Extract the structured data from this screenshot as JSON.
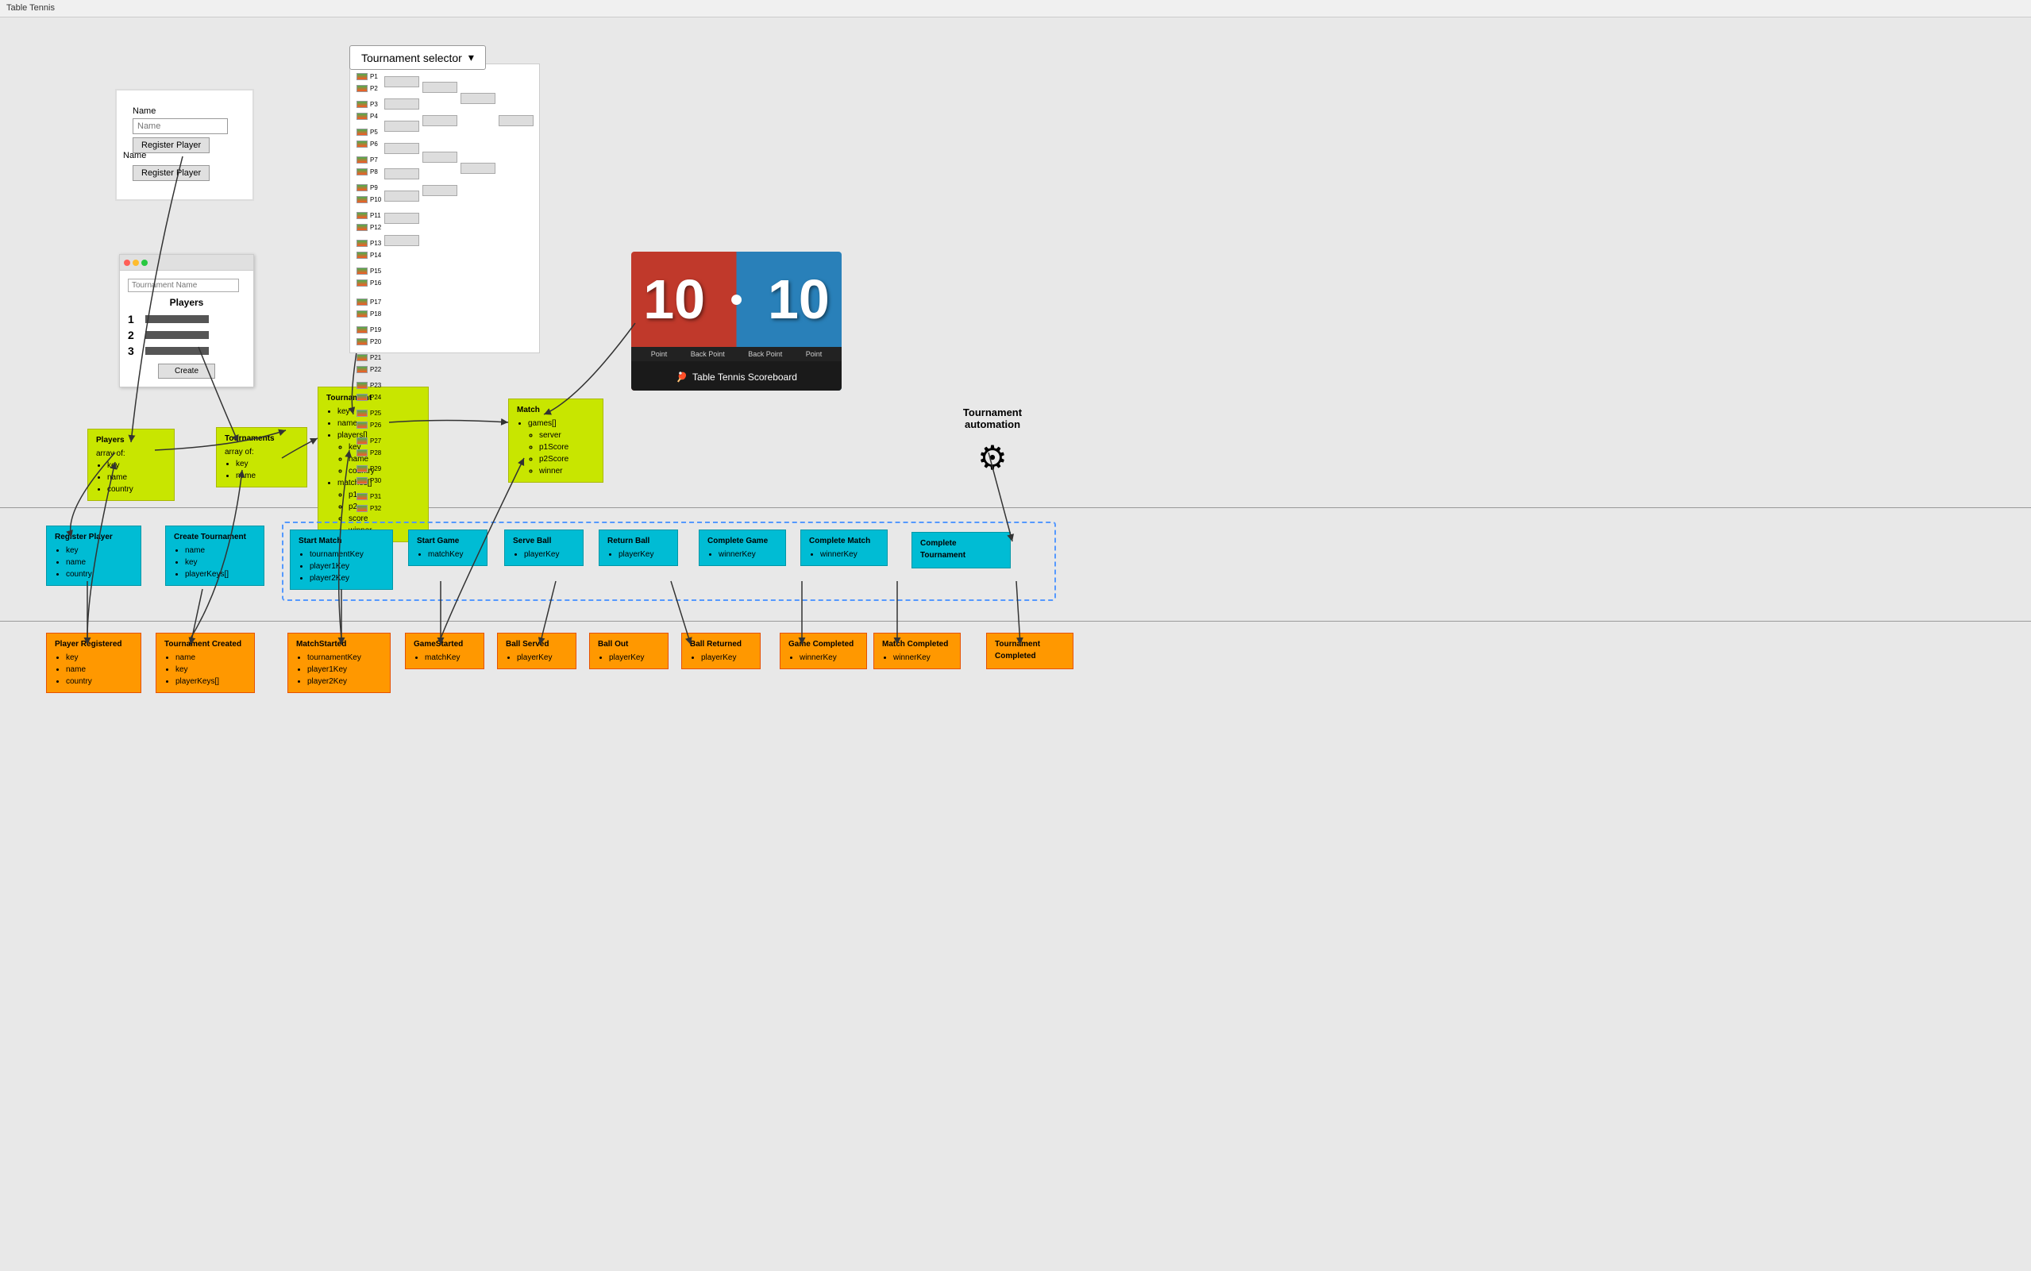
{
  "app": {
    "title": "Table Tennis"
  },
  "tournament_selector": {
    "label": "Tournament selector",
    "chevron": "▾"
  },
  "players_data_box": {
    "title": "Players",
    "subtitle": "array of:",
    "fields": [
      "key",
      "name",
      "country"
    ]
  },
  "tournaments_data_box": {
    "title": "Tournaments",
    "subtitle": "array of:",
    "fields": [
      "key",
      "name"
    ]
  },
  "tournament_data_box": {
    "title": "Tournament",
    "fields": [
      "key",
      "name",
      "players[]",
      "key",
      "name",
      "country",
      "matches[]",
      "p1",
      "p2",
      "score",
      "winner"
    ]
  },
  "match_data_box": {
    "title": "Match",
    "fields": [
      "games[]",
      "server",
      "p1Score",
      "p2Score",
      "winner"
    ]
  },
  "commands": [
    {
      "title": "Register Player",
      "fields": [
        "key",
        "name",
        "country"
      ]
    },
    {
      "title": "Create Tournament",
      "fields": [
        "name",
        "key",
        "playerKeys[]"
      ]
    },
    {
      "title": "Start Match",
      "fields": [
        "tournamentKey",
        "player1Key",
        "player2Key"
      ]
    },
    {
      "title": "Start Game",
      "fields": [
        "matchKey"
      ]
    },
    {
      "title": "Serve Ball",
      "fields": [
        "playerKey"
      ]
    },
    {
      "title": "Return Ball",
      "fields": [
        "playerKey"
      ]
    },
    {
      "title": "Complete Game",
      "fields": [
        "winnerKey"
      ]
    },
    {
      "title": "Complete Match",
      "fields": [
        "winnerKey"
      ]
    },
    {
      "title": "Complete Tournament",
      "fields": []
    }
  ],
  "events": [
    {
      "title": "Player Registered",
      "fields": [
        "key",
        "name",
        "country"
      ]
    },
    {
      "title": "Tournament Created",
      "fields": [
        "name",
        "key",
        "playerKeys[]"
      ]
    },
    {
      "title": "MatchStarted",
      "fields": [
        "tournamentKey",
        "player1Key",
        "player2Key"
      ]
    },
    {
      "title": "GameStarted",
      "fields": [
        "matchKey"
      ]
    },
    {
      "title": "Ball Served",
      "fields": [
        "playerKey"
      ]
    },
    {
      "title": "Ball Out",
      "fields": [
        "playerKey"
      ]
    },
    {
      "title": "Ball Returned",
      "fields": [
        "playerKey"
      ]
    },
    {
      "title": "Game Completed",
      "fields": [
        "winnerKey"
      ]
    },
    {
      "title": "Match Completed",
      "fields": [
        "winnerKey"
      ]
    },
    {
      "title": "Tournament Completed",
      "fields": []
    }
  ],
  "scoreboard": {
    "score_left": "10",
    "score_right": "10",
    "score_divider": "●",
    "buttons": [
      "Point",
      "Back Point",
      "Back Point",
      "Point"
    ],
    "footer_label": "Table Tennis Scoreboard",
    "footer_icon": "🏓"
  },
  "tournament_automation": {
    "label": "Tournament automation"
  },
  "register_form": {
    "label": "Name",
    "input_placeholder": "Name",
    "btn1": "Register Player",
    "btn2": "Register Player"
  },
  "create_form": {
    "input_placeholder": "Tournament Name",
    "section_title": "Players",
    "players": [
      "1",
      "2",
      "3"
    ],
    "create_btn": "Create"
  },
  "bracket": {
    "players": [
      "P1",
      "P2",
      "P3",
      "P4",
      "P5",
      "P6",
      "P7",
      "P8",
      "P9",
      "P10",
      "P11",
      "P12",
      "P13",
      "P14",
      "P15",
      "P16",
      "P17",
      "P18",
      "P19",
      "P20",
      "P21",
      "P22",
      "P23",
      "P24",
      "P25",
      "P26",
      "P27",
      "P28",
      "P29",
      "P30",
      "P31",
      "P32"
    ]
  }
}
